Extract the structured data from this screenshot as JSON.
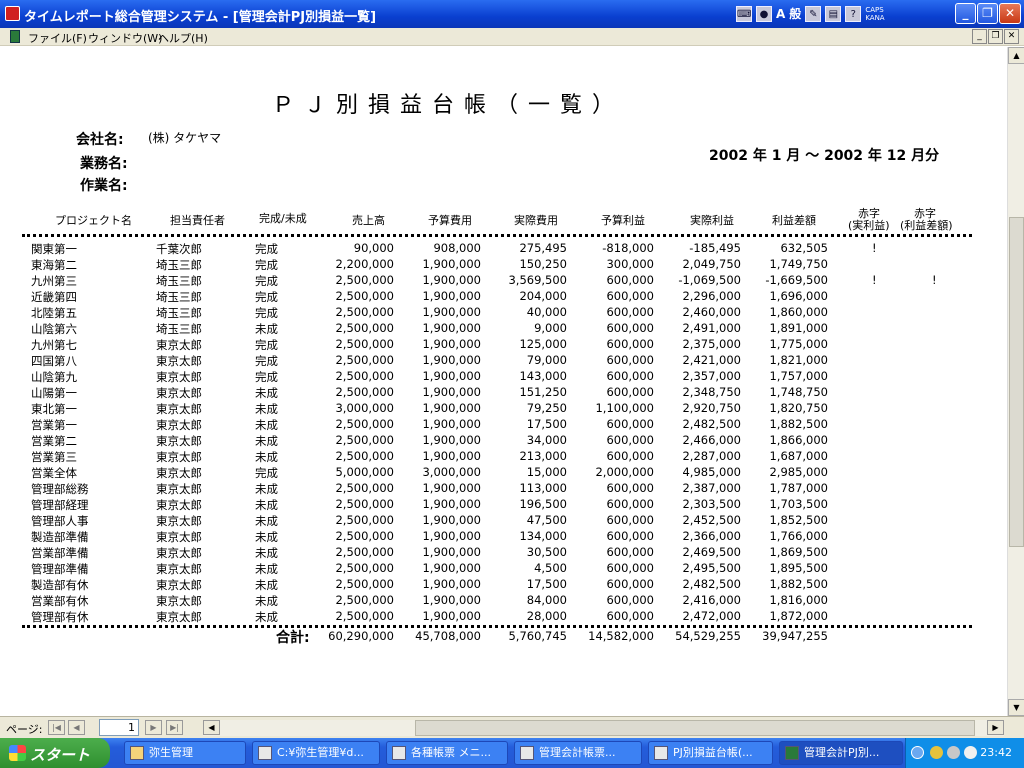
{
  "window": {
    "title": "タイムレポート総合管理システム - [管理会計PJ別損益一覧]",
    "ime_mode": "A",
    "ime_label": "般",
    "caps": "CAPS",
    "kana": "KANA"
  },
  "menu": {
    "items": [
      "ファイル(F)",
      "ウィンドウ(W)",
      "ヘルプ(H)"
    ]
  },
  "report": {
    "title": "ＰＪ別損益台帳（一覧）",
    "company_label": "会社名:",
    "company_value": "(株) タケヤマ",
    "business_label": "業務名:",
    "work_label": "作業名:",
    "period": "2002 年 1 月 ～ 2002 年 12 月分",
    "columns": {
      "name": "プロジェクト名",
      "manager": "担当責任者",
      "status": "完成/未成",
      "sales": "売上高",
      "budget_cost": "予算費用",
      "actual_cost": "実際費用",
      "budget_profit": "予算利益",
      "actual_profit": "実際利益",
      "diff": "利益差額",
      "flag1_top": "赤字",
      "flag1_bottom": "(実利益)",
      "flag2_top": "赤字",
      "flag2_bottom": "(利益差額)"
    },
    "rows": [
      {
        "name": "関東第一",
        "manager": "千葉次郎",
        "status": "完成",
        "sales": "90,000",
        "budget_cost": "908,000",
        "actual_cost": "275,495",
        "budget_profit": "-818,000",
        "actual_profit": "-185,495",
        "diff": "632,505",
        "flag1": "!",
        "flag2": ""
      },
      {
        "name": "東海第二",
        "manager": "埼玉三郎",
        "status": "完成",
        "sales": "2,200,000",
        "budget_cost": "1,900,000",
        "actual_cost": "150,250",
        "budget_profit": "300,000",
        "actual_profit": "2,049,750",
        "diff": "1,749,750",
        "flag1": "",
        "flag2": ""
      },
      {
        "name": "九州第三",
        "manager": "埼玉三郎",
        "status": "完成",
        "sales": "2,500,000",
        "budget_cost": "1,900,000",
        "actual_cost": "3,569,500",
        "budget_profit": "600,000",
        "actual_profit": "-1,069,500",
        "diff": "-1,669,500",
        "flag1": "!",
        "flag2": "!"
      },
      {
        "name": "近畿第四",
        "manager": "埼玉三郎",
        "status": "完成",
        "sales": "2,500,000",
        "budget_cost": "1,900,000",
        "actual_cost": "204,000",
        "budget_profit": "600,000",
        "actual_profit": "2,296,000",
        "diff": "1,696,000",
        "flag1": "",
        "flag2": ""
      },
      {
        "name": "北陸第五",
        "manager": "埼玉三郎",
        "status": "完成",
        "sales": "2,500,000",
        "budget_cost": "1,900,000",
        "actual_cost": "40,000",
        "budget_profit": "600,000",
        "actual_profit": "2,460,000",
        "diff": "1,860,000",
        "flag1": "",
        "flag2": ""
      },
      {
        "name": "山陰第六",
        "manager": "埼玉三郎",
        "status": "未成",
        "sales": "2,500,000",
        "budget_cost": "1,900,000",
        "actual_cost": "9,000",
        "budget_profit": "600,000",
        "actual_profit": "2,491,000",
        "diff": "1,891,000",
        "flag1": "",
        "flag2": ""
      },
      {
        "name": "九州第七",
        "manager": "東京太郎",
        "status": "完成",
        "sales": "2,500,000",
        "budget_cost": "1,900,000",
        "actual_cost": "125,000",
        "budget_profit": "600,000",
        "actual_profit": "2,375,000",
        "diff": "1,775,000",
        "flag1": "",
        "flag2": ""
      },
      {
        "name": "四国第八",
        "manager": "東京太郎",
        "status": "完成",
        "sales": "2,500,000",
        "budget_cost": "1,900,000",
        "actual_cost": "79,000",
        "budget_profit": "600,000",
        "actual_profit": "2,421,000",
        "diff": "1,821,000",
        "flag1": "",
        "flag2": ""
      },
      {
        "name": "山陰第九",
        "manager": "東京太郎",
        "status": "完成",
        "sales": "2,500,000",
        "budget_cost": "1,900,000",
        "actual_cost": "143,000",
        "budget_profit": "600,000",
        "actual_profit": "2,357,000",
        "diff": "1,757,000",
        "flag1": "",
        "flag2": ""
      },
      {
        "name": "山陽第一",
        "manager": "東京太郎",
        "status": "未成",
        "sales": "2,500,000",
        "budget_cost": "1,900,000",
        "actual_cost": "151,250",
        "budget_profit": "600,000",
        "actual_profit": "2,348,750",
        "diff": "1,748,750",
        "flag1": "",
        "flag2": ""
      },
      {
        "name": "東北第一",
        "manager": "東京太郎",
        "status": "未成",
        "sales": "3,000,000",
        "budget_cost": "1,900,000",
        "actual_cost": "79,250",
        "budget_profit": "1,100,000",
        "actual_profit": "2,920,750",
        "diff": "1,820,750",
        "flag1": "",
        "flag2": ""
      },
      {
        "name": "営業第一",
        "manager": "東京太郎",
        "status": "未成",
        "sales": "2,500,000",
        "budget_cost": "1,900,000",
        "actual_cost": "17,500",
        "budget_profit": "600,000",
        "actual_profit": "2,482,500",
        "diff": "1,882,500",
        "flag1": "",
        "flag2": ""
      },
      {
        "name": "営業第二",
        "manager": "東京太郎",
        "status": "未成",
        "sales": "2,500,000",
        "budget_cost": "1,900,000",
        "actual_cost": "34,000",
        "budget_profit": "600,000",
        "actual_profit": "2,466,000",
        "diff": "1,866,000",
        "flag1": "",
        "flag2": ""
      },
      {
        "name": "営業第三",
        "manager": "東京太郎",
        "status": "未成",
        "sales": "2,500,000",
        "budget_cost": "1,900,000",
        "actual_cost": "213,000",
        "budget_profit": "600,000",
        "actual_profit": "2,287,000",
        "diff": "1,687,000",
        "flag1": "",
        "flag2": ""
      },
      {
        "name": "営業全体",
        "manager": "東京太郎",
        "status": "完成",
        "sales": "5,000,000",
        "budget_cost": "3,000,000",
        "actual_cost": "15,000",
        "budget_profit": "2,000,000",
        "actual_profit": "4,985,000",
        "diff": "2,985,000",
        "flag1": "",
        "flag2": ""
      },
      {
        "name": "管理部総務",
        "manager": "東京太郎",
        "status": "未成",
        "sales": "2,500,000",
        "budget_cost": "1,900,000",
        "actual_cost": "113,000",
        "budget_profit": "600,000",
        "actual_profit": "2,387,000",
        "diff": "1,787,000",
        "flag1": "",
        "flag2": ""
      },
      {
        "name": "管理部経理",
        "manager": "東京太郎",
        "status": "未成",
        "sales": "2,500,000",
        "budget_cost": "1,900,000",
        "actual_cost": "196,500",
        "budget_profit": "600,000",
        "actual_profit": "2,303,500",
        "diff": "1,703,500",
        "flag1": "",
        "flag2": ""
      },
      {
        "name": "管理部人事",
        "manager": "東京太郎",
        "status": "未成",
        "sales": "2,500,000",
        "budget_cost": "1,900,000",
        "actual_cost": "47,500",
        "budget_profit": "600,000",
        "actual_profit": "2,452,500",
        "diff": "1,852,500",
        "flag1": "",
        "flag2": ""
      },
      {
        "name": "製造部準備",
        "manager": "東京太郎",
        "status": "未成",
        "sales": "2,500,000",
        "budget_cost": "1,900,000",
        "actual_cost": "134,000",
        "budget_profit": "600,000",
        "actual_profit": "2,366,000",
        "diff": "1,766,000",
        "flag1": "",
        "flag2": ""
      },
      {
        "name": "営業部準備",
        "manager": "東京太郎",
        "status": "未成",
        "sales": "2,500,000",
        "budget_cost": "1,900,000",
        "actual_cost": "30,500",
        "budget_profit": "600,000",
        "actual_profit": "2,469,500",
        "diff": "1,869,500",
        "flag1": "",
        "flag2": ""
      },
      {
        "name": "管理部準備",
        "manager": "東京太郎",
        "status": "未成",
        "sales": "2,500,000",
        "budget_cost": "1,900,000",
        "actual_cost": "4,500",
        "budget_profit": "600,000",
        "actual_profit": "2,495,500",
        "diff": "1,895,500",
        "flag1": "",
        "flag2": ""
      },
      {
        "name": "製造部有休",
        "manager": "東京太郎",
        "status": "未成",
        "sales": "2,500,000",
        "budget_cost": "1,900,000",
        "actual_cost": "17,500",
        "budget_profit": "600,000",
        "actual_profit": "2,482,500",
        "diff": "1,882,500",
        "flag1": "",
        "flag2": ""
      },
      {
        "name": "営業部有休",
        "manager": "東京太郎",
        "status": "未成",
        "sales": "2,500,000",
        "budget_cost": "1,900,000",
        "actual_cost": "84,000",
        "budget_profit": "600,000",
        "actual_profit": "2,416,000",
        "diff": "1,816,000",
        "flag1": "",
        "flag2": ""
      },
      {
        "name": "管理部有休",
        "manager": "東京太郎",
        "status": "未成",
        "sales": "2,500,000",
        "budget_cost": "1,900,000",
        "actual_cost": "28,000",
        "budget_profit": "600,000",
        "actual_profit": "2,472,000",
        "diff": "1,872,000",
        "flag1": "",
        "flag2": ""
      }
    ],
    "totals": {
      "label": "合計:",
      "sales": "60,290,000",
      "budget_cost": "45,708,000",
      "actual_cost": "5,760,745",
      "budget_profit": "14,582,000",
      "actual_profit": "54,529,255",
      "diff": "39,947,255"
    }
  },
  "navigation": {
    "page_label": "ページ:",
    "current_page": "1"
  },
  "taskbar": {
    "start_label": "スタート",
    "tasks": [
      "弥生管理",
      "C:¥弥生管理¥d...",
      "各種帳票 メニ...",
      "管理会計帳票...",
      "PJ別損益台帳(...",
      "管理会計PJ別..."
    ],
    "clock": "23:42"
  }
}
